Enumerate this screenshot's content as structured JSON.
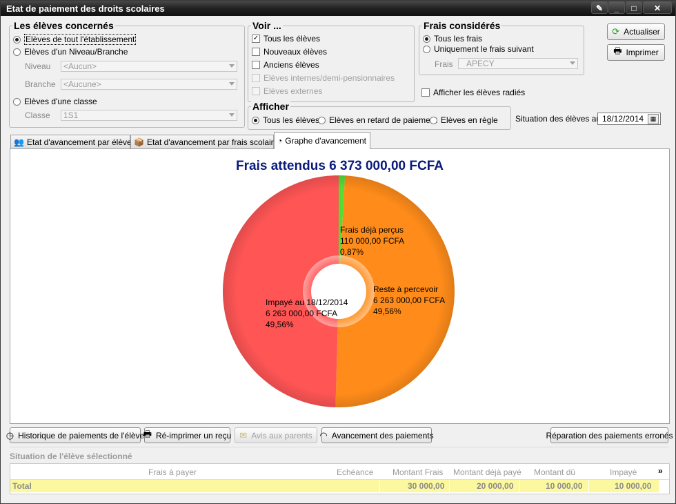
{
  "window": {
    "title": "Etat de paiement des droits scolaires"
  },
  "eleves": {
    "title": "Les élèves concernés",
    "opt_all": "Elèves de tout l'établissement",
    "opt_niveau": "Elèves d'un Niveau/Branche",
    "niveau_label": "Niveau",
    "niveau_value": "<Aucun>",
    "branche_label": "Branche",
    "branche_value": "<Aucune>",
    "opt_classe": "Elèves d'une classe",
    "classe_label": "Classe",
    "classe_value": "1S1"
  },
  "voir": {
    "title": "Voir ...",
    "tous": "Tous les élèves",
    "nouveaux": "Nouveaux élèves",
    "anciens": "Anciens élèves",
    "internes": "Elèves internes/demi-pensionnaires",
    "externes": "Elèves externes"
  },
  "frais": {
    "title": "Frais considérés",
    "tous": "Tous les frais",
    "unique": "Uniquement le frais suivant",
    "frais_label": "Frais",
    "frais_value": "APECY"
  },
  "radies": "Afficher les élèves radiés",
  "afficher": {
    "title": "Afficher",
    "tous": "Tous les élèves",
    "retard": "Elèves en retard de paiement",
    "regle": "Elèves en règle"
  },
  "situation": {
    "label": "Situation des élèves au",
    "date": "18/12/2014"
  },
  "buttons": {
    "actualiser": "Actualiser",
    "imprimer": "Imprimer"
  },
  "tabs": [
    "Etat d'avancement par élève",
    "Etat d'avancement par frais scolaire",
    "Graphe d'avancement"
  ],
  "chart_data": {
    "type": "pie",
    "title": "Frais attendus 6 373 000,00 FCFA",
    "slices": [
      {
        "label": "Frais déjà perçus",
        "amount": "110 000,00 FCFA",
        "percent": "0,87%",
        "value": 0.87,
        "color": "#55dd33"
      },
      {
        "label": "Reste à percevoir",
        "amount": "6 263 000,00 FCFA",
        "percent": "49,56%",
        "value": 49.56,
        "color": "#ff8c1a"
      },
      {
        "label": "Impayé au 18/12/2014",
        "amount": "6 263 000,00 FCFA",
        "percent": "49,56%",
        "value": 49.56,
        "color": "#ff5555"
      }
    ]
  },
  "actions": {
    "historique": "Historique de paiements de l'élève",
    "reimprimer": "Ré-imprimer un reçu",
    "avis": "Avis aux parents",
    "avancement": "Avancement des paiements",
    "reparation": "Réparation des paiements erronés"
  },
  "section_title": "Situation de l'élève sélectionné",
  "table": {
    "headers": [
      "Frais à payer",
      "Echéance",
      "Montant Frais",
      "Montant déjà payé",
      "Montant dû",
      "Impayé"
    ],
    "total_label": "Total",
    "totals": [
      "30 000,00",
      "20 000,00",
      "10 000,00",
      "10 000,00"
    ]
  }
}
